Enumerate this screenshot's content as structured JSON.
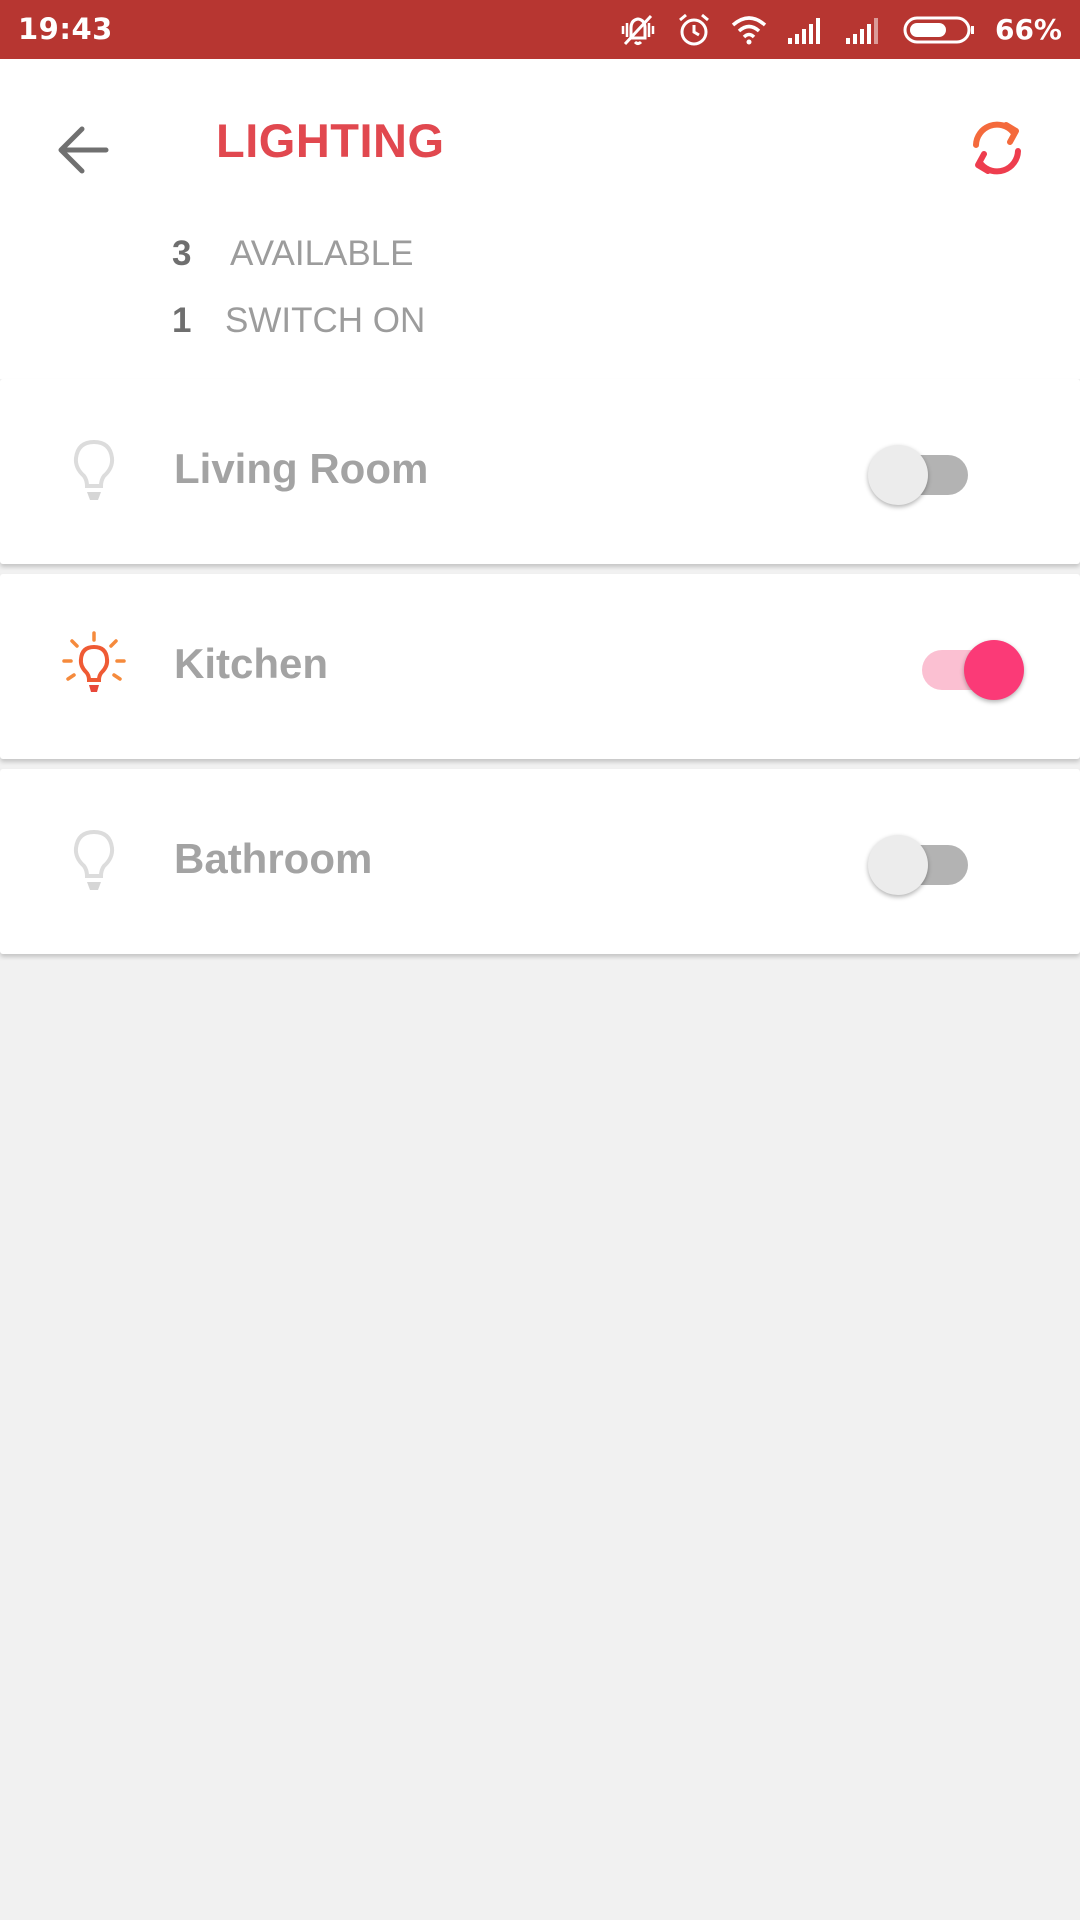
{
  "status_bar": {
    "time": "19:43",
    "icons": [
      "mute-vibrate-icon",
      "alarm-icon",
      "wifi-icon",
      "signal-icon",
      "signal-icon",
      "battery-icon"
    ],
    "battery_level": 0.66,
    "battery_text": "66%"
  },
  "header": {
    "back_icon": "arrow-left-icon",
    "title": "LIGHTING",
    "refresh_icon": "refresh-icon",
    "stats": {
      "available_count": "3",
      "available_label": "AVAILABLE",
      "on_count": "1",
      "on_label": "SWITCH ON"
    }
  },
  "lights": [
    {
      "name": "Living Room",
      "on": false,
      "icon": "bulb-off-icon"
    },
    {
      "name": "Kitchen",
      "on": true,
      "icon": "bulb-on-icon"
    },
    {
      "name": "Bathroom",
      "on": false,
      "icon": "bulb-off-icon"
    }
  ],
  "colors": {
    "status_bar": "#b73631",
    "title": "#e1484f",
    "toggle_on_thumb": "#fb3a77",
    "toggle_on_track": "#fbc0d2",
    "bulb_on": "#ef5a34",
    "background": "#f1f1f1"
  }
}
